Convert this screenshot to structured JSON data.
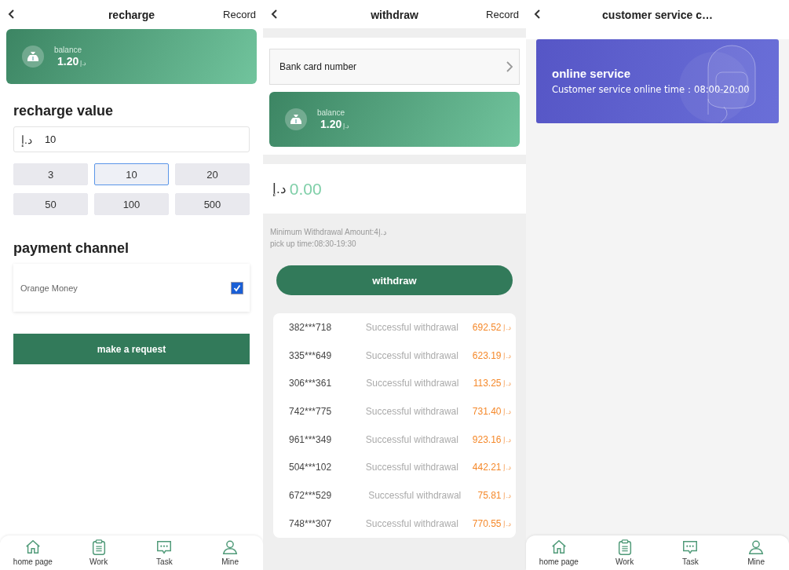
{
  "recharge_screen": {
    "header": {
      "title": "recharge",
      "action": "Record"
    },
    "balance": {
      "label": "balance",
      "amount": "1.20",
      "currency": "د.إ"
    },
    "recharge_value": {
      "heading": "recharge value",
      "currency": "د.إ",
      "value": "10"
    },
    "amounts": [
      {
        "label": "3",
        "selected": false
      },
      {
        "label": "10",
        "selected": true
      },
      {
        "label": "20",
        "selected": false
      },
      {
        "label": "50",
        "selected": false
      },
      {
        "label": "100",
        "selected": false
      },
      {
        "label": "500",
        "selected": false
      }
    ],
    "payment_channel": {
      "heading": "payment channel",
      "options": [
        {
          "label": "Orange Money",
          "checked": true
        }
      ]
    },
    "submit": "make a request",
    "tab_bar": [
      {
        "kind": "home",
        "label": "home page"
      },
      {
        "kind": "work",
        "label": "Work"
      },
      {
        "kind": "task",
        "label": "Task"
      },
      {
        "kind": "mine",
        "label": "Mine"
      }
    ]
  },
  "withdraw_screen": {
    "header": {
      "title": "withdraw",
      "action": "Record"
    },
    "bank_card": {
      "label": "Bank card number"
    },
    "balance": {
      "label": "balance",
      "amount": "1.20",
      "currency": "د.إ"
    },
    "amount": {
      "currency": "د.إ",
      "value": "0.00"
    },
    "info": [
      "Minimum Withdrawal Amount:4د.إ",
      "pick up time:08:30-19:30"
    ],
    "submit": "withdraw",
    "records": [
      {
        "account": "382***718",
        "status": "Successful withdrawal",
        "amount": "692.52",
        "currency": "د.إ"
      },
      {
        "account": "335***649",
        "status": "Successful withdrawal",
        "amount": "623.19",
        "currency": "د.إ"
      },
      {
        "account": "306***361",
        "status": "Successful withdrawal",
        "amount": "113.25",
        "currency": "د.إ"
      },
      {
        "account": "742***775",
        "status": "Successful withdrawal",
        "amount": "731.40",
        "currency": "د.إ"
      },
      {
        "account": "961***349",
        "status": "Successful withdrawal",
        "amount": "923.16",
        "currency": "د.إ"
      },
      {
        "account": "504***102",
        "status": "Successful withdrawal",
        "amount": "442.21",
        "currency": "د.إ"
      },
      {
        "account": "672***529",
        "status": "Successful withdrawal",
        "amount": "75.81",
        "currency": "د.إ"
      },
      {
        "account": "748***307",
        "status": "Successful withdrawal",
        "amount": "770.55",
        "currency": "د.إ"
      }
    ]
  },
  "service_screen": {
    "header": {
      "title": "customer service c…"
    },
    "service_card": {
      "title": "online service",
      "subtitle": "Customer service online time：08:00-20:00"
    },
    "tab_bar": [
      {
        "kind": "home",
        "label": "home page"
      },
      {
        "kind": "work",
        "label": "Work"
      },
      {
        "kind": "task",
        "label": "Task"
      },
      {
        "kind": "mine",
        "label": "Mine"
      }
    ]
  }
}
